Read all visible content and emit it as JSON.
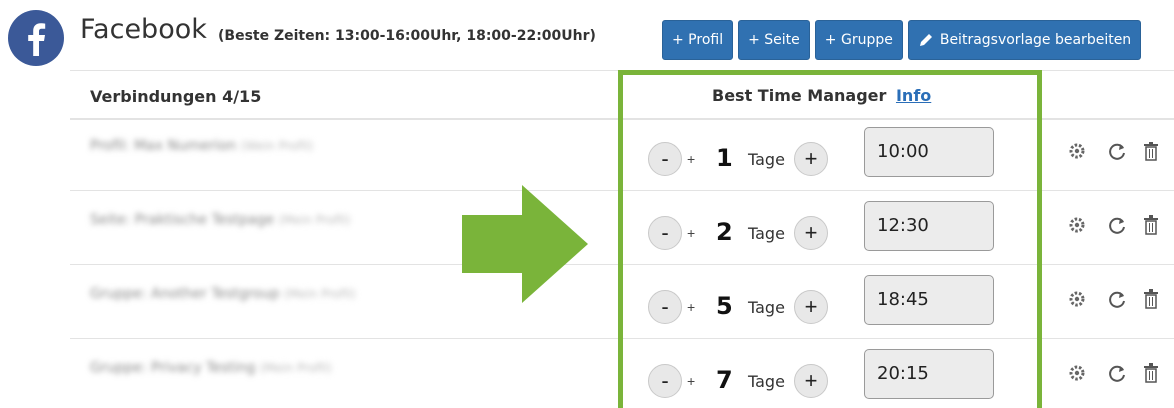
{
  "header": {
    "title": "Facebook",
    "best_times": "(Beste Zeiten: 13:00-16:00Uhr, 18:00-22:00Uhr)"
  },
  "toolbar": {
    "profil_label": "+ Profil",
    "seite_label": "+ Seite",
    "gruppe_label": "+ Gruppe",
    "template_label": "Beitragsvorlage bearbeiten"
  },
  "table": {
    "connections_header": "Verbindungen 4/15",
    "btm_header": "Best Time Manager",
    "btm_info_link": "Info",
    "rows": [
      {
        "name": "Profil: Max Numerion",
        "meta": "(Wein Profil)",
        "minus": "-",
        "small_plus": "+",
        "days": "1",
        "days_label": "Tage",
        "plus": "+",
        "time": "10:00"
      },
      {
        "name": "Seite: Praktische Testpage",
        "meta": "(Mein Profil)",
        "minus": "-",
        "small_plus": "+",
        "days": "2",
        "days_label": "Tage",
        "plus": "+",
        "time": "12:30"
      },
      {
        "name": "Gruppe: Another Testgroup",
        "meta": "(Mein Profil)",
        "minus": "-",
        "small_plus": "+",
        "days": "5",
        "days_label": "Tage",
        "plus": "+",
        "time": "18:45"
      },
      {
        "name": "Gruppe: Privacy Testing",
        "meta": "(Mein Profil)",
        "minus": "-",
        "small_plus": "+",
        "days": "7",
        "days_label": "Tage",
        "plus": "+",
        "time": "20:15"
      }
    ]
  },
  "colors": {
    "button_blue": "#3071b1",
    "highlight_green": "#7ab43a",
    "facebook_blue": "#3b5998"
  }
}
